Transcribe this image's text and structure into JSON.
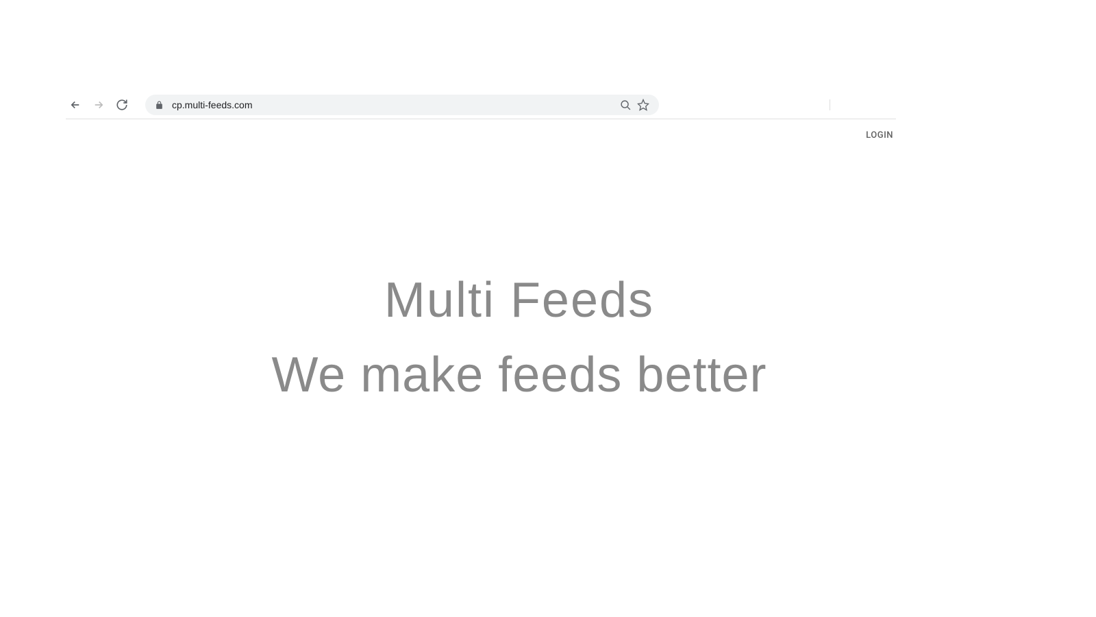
{
  "browser": {
    "url": "cp.multi-feeds.com"
  },
  "header": {
    "login_label": "LOGIN"
  },
  "hero": {
    "title": "Multi Feeds",
    "subtitle": "We make feeds better"
  }
}
